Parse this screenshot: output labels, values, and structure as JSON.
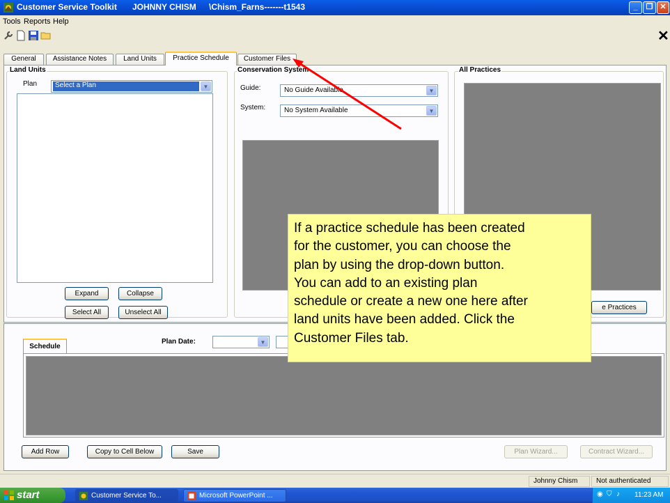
{
  "window": {
    "app_title": "Customer Service Toolkit",
    "user": "JOHNNY CHISM",
    "path": "\\Chism_Farns-------t1543"
  },
  "menu": [
    "Tools",
    "Reports",
    "Help"
  ],
  "tabs": [
    "General",
    "Assistance Notes",
    "Land Units",
    "Practice Schedule",
    "Customer Files"
  ],
  "active_tab": "Practice Schedule",
  "land_units": {
    "group_label": "Land Units",
    "plan_label": "Plan",
    "plan_value": "Select a Plan",
    "expand": "Expand",
    "collapse": "Collapse",
    "select_all": "Select All",
    "unselect_all": "Unselect All"
  },
  "conservation": {
    "group_label": "Conservation System",
    "guide_label": "Guide:",
    "guide_value": "No Guide Available",
    "system_label": "System:",
    "system_value": "No System Available"
  },
  "all_practices": {
    "group_label": "All Practices",
    "button_partial": "e Practices"
  },
  "schedule": {
    "tab_label": "Schedule",
    "plan_date_label": "Plan Date:",
    "add_row": "Add Row",
    "copy_cell": "Copy to Cell Below",
    "save": "Save",
    "plan_wizard": "Plan Wizard...",
    "contract_wizard": "Contract Wizard..."
  },
  "callout_lines": [
    "If a practice schedule has been created",
    "for the customer, you can choose the",
    "plan by using the drop-down button.",
    "You can add to an existing plan",
    "schedule or create a new one here after",
    "land units have been added. Click the",
    "Customer Files tab."
  ],
  "status": {
    "user": "Johnny Chism",
    "auth": "Not authenticated"
  },
  "taskbar": {
    "start": "start",
    "items": [
      "Customer Service To...",
      "Microsoft PowerPoint ..."
    ],
    "clock": "11:23 AM"
  },
  "colors": {
    "callout_bg": "#ffff99",
    "arrow": "#ff0000",
    "title_blue": "#0a4fd6"
  }
}
